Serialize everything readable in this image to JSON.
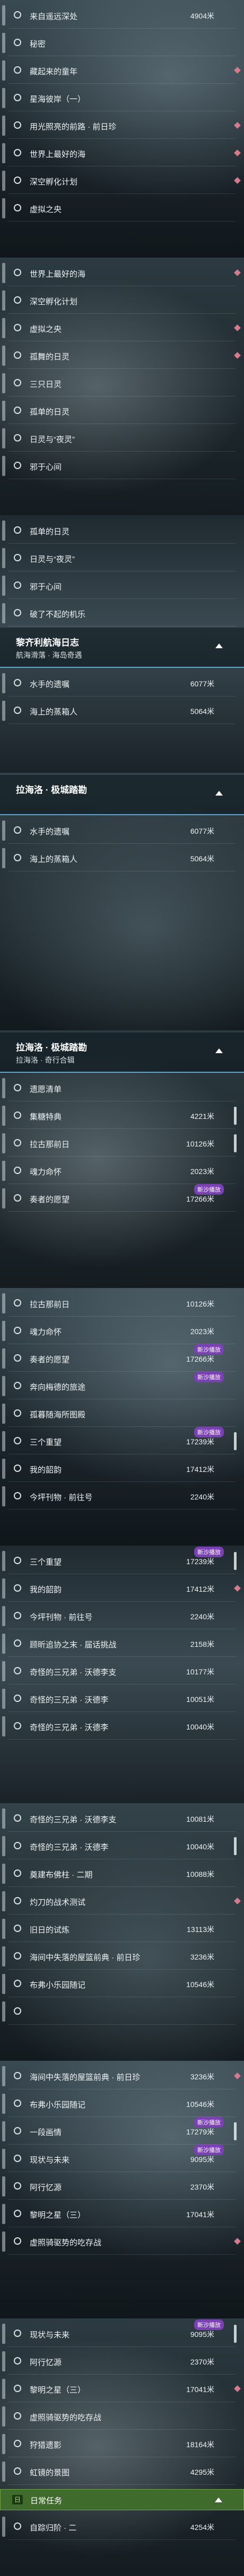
{
  "badge_label": "新沙播放",
  "sections": [
    {
      "rows": [
        {
          "label": "来自遥远深处",
          "value": "4904米"
        },
        {
          "label": "秘密",
          "value": ""
        },
        {
          "label": "藏起来的童年",
          "value": ""
        },
        {
          "label": "星海彼岸（一）",
          "value": ""
        },
        {
          "label": "用光照亮的前路 · 前日珍",
          "value": ""
        },
        {
          "label": "世界上最好的海",
          "value": ""
        },
        {
          "label": "深空孵化计划",
          "value": ""
        },
        {
          "label": "虚拟之央",
          "value": ""
        }
      ]
    },
    {
      "rows": [
        {
          "label": "世界上最好的海",
          "value": ""
        },
        {
          "label": "深空孵化计划",
          "value": ""
        },
        {
          "label": "虚拟之央",
          "value": ""
        },
        {
          "label": "孤舞的日灵",
          "value": ""
        },
        {
          "label": "三只日灵",
          "value": ""
        },
        {
          "label": "孤单的日灵",
          "value": ""
        },
        {
          "label": "日灵与“夜灵”",
          "value": ""
        },
        {
          "label": "邪于心间",
          "value": ""
        }
      ]
    },
    {
      "rows": [
        {
          "label": "孤单的日灵",
          "value": ""
        },
        {
          "label": "日灵与“夜灵”",
          "value": ""
        },
        {
          "label": "邪于心间",
          "value": ""
        },
        {
          "label": "破了不起的机乐",
          "value": ""
        }
      ],
      "header": {
        "title": "黎齐利航海日志",
        "subtitle": "航海滑落 · 海岛奇遇"
      },
      "rows2": [
        {
          "label": "水手的遗嘱",
          "value": "6077米"
        },
        {
          "label": "海上的蒸箱人",
          "value": "5064米"
        }
      ]
    },
    {
      "header": {
        "title": "拉海洛 · 极城踏勘",
        "subtitle": ""
      },
      "rows": [
        {
          "label": "水手的遗嘱",
          "value": "6077米"
        },
        {
          "label": "海上的蒸箱人",
          "value": "5064米"
        }
      ]
    },
    {
      "header": {
        "title": "拉海洛 · 极城踏勘",
        "subtitle": "拉海洛 · 奇行合辑"
      },
      "rows": [
        {
          "label": "遗愿清单",
          "value": ""
        },
        {
          "label": "集糖特典",
          "value": "4221米"
        },
        {
          "label": "拉古那前日",
          "value": "10126米"
        },
        {
          "label": "魂力命怀",
          "value": "2023米"
        },
        {
          "label": "奏者的愿望",
          "value": "17266米"
        }
      ]
    },
    {
      "rows": [
        {
          "label": "拉古那前日",
          "value": "10126米"
        },
        {
          "label": "魂力命怀",
          "value": "2023米"
        },
        {
          "label": "奏者的愿望",
          "value": "17266米"
        },
        {
          "label": "奔向梅德的旅途",
          "value": ""
        },
        {
          "label": "孤暮随海所图殿",
          "value": ""
        },
        {
          "label": "三个重望",
          "value": "17239米"
        },
        {
          "label": "我的韶韵",
          "value": "17412米"
        },
        {
          "label": "今坪刊物 · 前往号",
          "value": "2240米"
        }
      ]
    },
    {
      "rows": [
        {
          "label": "三个重望",
          "value": "17239米"
        },
        {
          "label": "我的韶韵",
          "value": "17412米"
        },
        {
          "label": "今坪刊物 · 前往号",
          "value": "2240米"
        },
        {
          "label": "顾昕追协之末 · 届话挑战",
          "value": "2158米"
        },
        {
          "label": "奇怪的三兄弟 · 沃德李支",
          "value": "10177米"
        },
        {
          "label": "奇怪的三兄弟 · 沃德李",
          "value": "10051米"
        },
        {
          "label": "奇怪的三兄弟 · 沃德李",
          "value": "10040米"
        }
      ]
    },
    {
      "rows": [
        {
          "label": "奇怪的三兄弟 · 沃德李支",
          "value": "10081米"
        },
        {
          "label": "奇怪的三兄弟 · 沃德李",
          "value": "10040米"
        },
        {
          "label": "奠建布佛柱 · 二期",
          "value": "10088米"
        },
        {
          "label": "灼刀的战术测试",
          "value": ""
        },
        {
          "label": "旧日的试炼",
          "value": "13113米"
        },
        {
          "label": "海间中失落的屋篮前典 · 前日珍",
          "value": "3236米"
        },
        {
          "label": "布弗小乐园随记",
          "value": "10546米"
        },
        {
          "label": "",
          "value": ""
        }
      ]
    },
    {
      "rows": [
        {
          "label": "海间中失落的屋篮前典 · 前日珍",
          "value": "3236米"
        },
        {
          "label": "布弗小乐园随记",
          "value": "10546米"
        },
        {
          "label": "一段画情",
          "value": "17279米"
        },
        {
          "label": "现状与未来",
          "value": "9095米"
        },
        {
          "label": "阿行忆源",
          "value": "2370米"
        },
        {
          "label": "黎明之星（三）",
          "value": "17041米"
        },
        {
          "label": "虚照骑驱势的吃存战",
          "value": ""
        }
      ]
    },
    {
      "rows": [
        {
          "label": "现状与未来",
          "value": "9095米"
        },
        {
          "label": "阿行忆源",
          "value": "2370米"
        },
        {
          "label": "黎明之星（三）",
          "value": "17041米"
        },
        {
          "label": "虚照骑驱势的吃存战",
          "value": ""
        },
        {
          "label": "狩猎遗影",
          "value": "18164米"
        },
        {
          "label": "虹镜的景图",
          "value": "4295米"
        }
      ],
      "daily": {
        "tag": "日",
        "title": "日常任务"
      },
      "rows2": [
        {
          "label": "自踪归阶 · 二",
          "value": "4254米"
        }
      ]
    }
  ]
}
